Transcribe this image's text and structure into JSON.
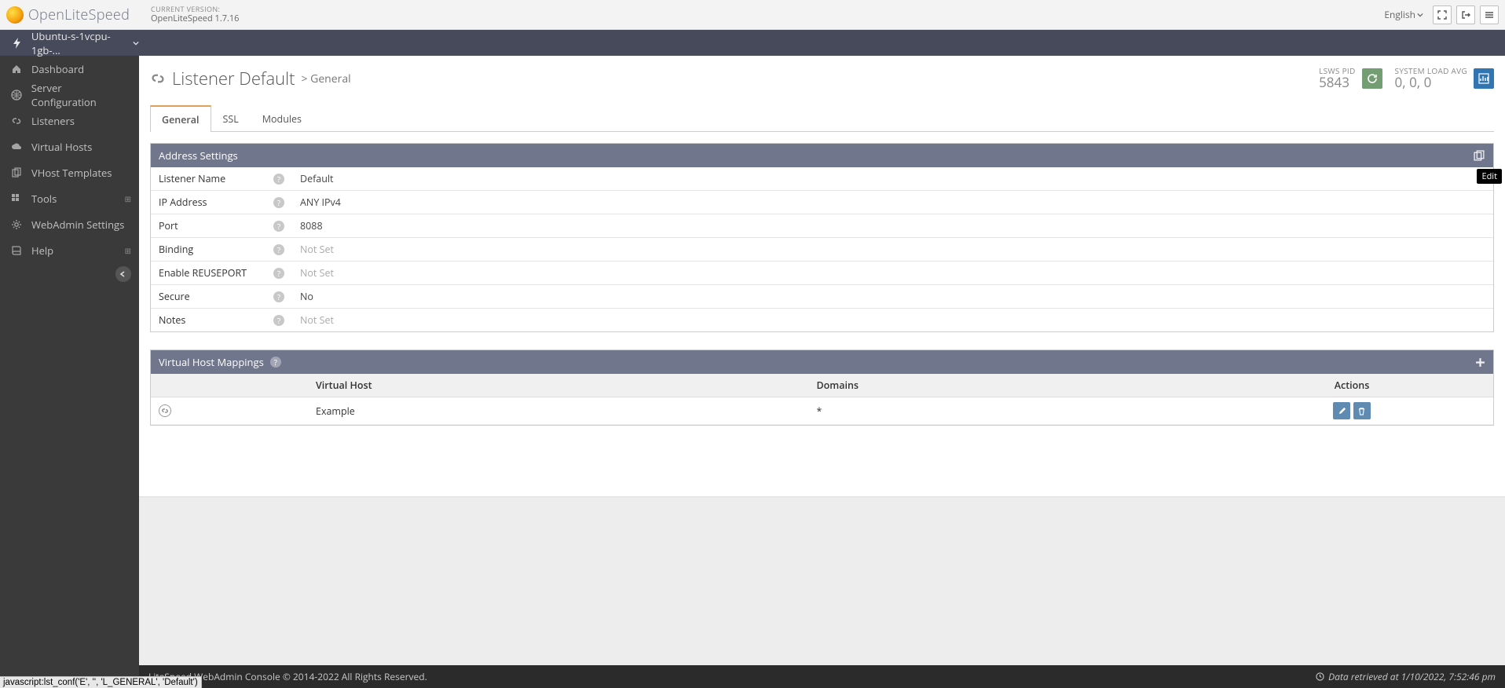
{
  "brand": "OpenLiteSpeed",
  "version": {
    "label": "CURRENT VERSION:",
    "value": "OpenLiteSpeed 1.7.16"
  },
  "language": "English",
  "hostname": "Ubuntu-s-1vcpu-1gb-...",
  "nav": {
    "dashboard": "Dashboard",
    "server_config": "Server Configuration",
    "listeners": "Listeners",
    "virtual_hosts": "Virtual Hosts",
    "vhost_templates": "VHost Templates",
    "tools": "Tools",
    "webadmin": "WebAdmin Settings",
    "help": "Help"
  },
  "page": {
    "title": "Listener Default",
    "crumb": "> General"
  },
  "stats": {
    "pid_label": "LSWS PID",
    "pid_value": "5843",
    "load_label": "SYSTEM LOAD AVG",
    "load_value": "0, 0, 0"
  },
  "tabs": {
    "general": "General",
    "ssl": "SSL",
    "modules": "Modules"
  },
  "address": {
    "title": "Address Settings",
    "rows": {
      "listener_name": {
        "label": "Listener Name",
        "value": "Default"
      },
      "ip_address": {
        "label": "IP Address",
        "value": "ANY IPv4"
      },
      "port": {
        "label": "Port",
        "value": "8088"
      },
      "binding": {
        "label": "Binding",
        "value": "Not Set"
      },
      "reuseport": {
        "label": "Enable REUSEPORT",
        "value": "Not Set"
      },
      "secure": {
        "label": "Secure",
        "value": "No"
      },
      "notes": {
        "label": "Notes",
        "value": "Not Set"
      }
    }
  },
  "mappings": {
    "title": "Virtual Host Mappings",
    "headers": {
      "vhost": "Virtual Host",
      "domains": "Domains",
      "actions": "Actions"
    },
    "row1": {
      "vhost": "Example",
      "domains": "*"
    }
  },
  "footer": {
    "copyright": "LiteSpeed WebAdmin Console © 2014-2022 All Rights Reserved.",
    "retrieved": "Data retrieved at 1/10/2022, 7:52:46 pm"
  },
  "tooltip": "Edit",
  "statusbar": "javascript:lst_conf('E', '', 'L_GENERAL', 'Default')"
}
